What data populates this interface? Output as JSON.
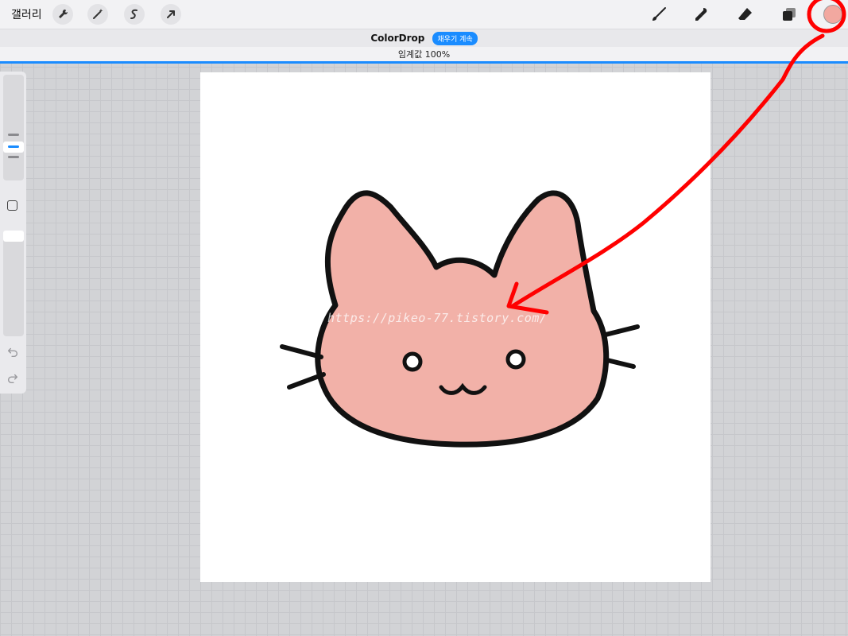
{
  "toolbar": {
    "gallery_label": "갤러리",
    "left_tools": [
      "wrench-icon",
      "magic-wand-icon",
      "selection-icon",
      "transform-arrow-icon"
    ],
    "right_tools": [
      "brush-icon",
      "smudge-icon",
      "eraser-icon",
      "layers-icon"
    ],
    "current_color": "#f2a8a0"
  },
  "header": {
    "title": "ColorDrop",
    "badge": "채우기 계속",
    "badge_color": "#1a8cff"
  },
  "threshold": {
    "label": "임계값 100%",
    "value_percent": 100,
    "accent": "#1a8cff"
  },
  "sidebar": {
    "icons": [
      "modify-square-icon",
      "undo-icon",
      "redo-icon"
    ]
  },
  "canvas": {
    "watermark": "https://pikeo-77.tistory.com/",
    "fill_color": "#f2b1a8",
    "outline_color": "#111111"
  },
  "annotation": {
    "color": "#ff0000"
  }
}
